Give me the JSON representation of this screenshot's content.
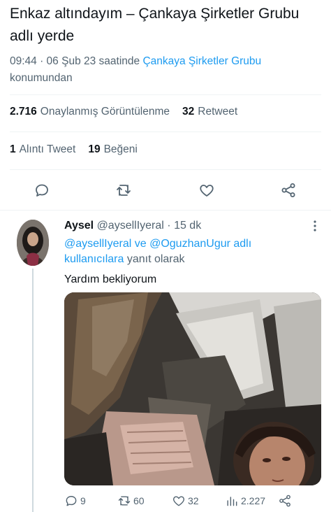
{
  "tweet": {
    "text": "Enkaz altındayım – Çankaya Şirketler Grubu adlı yerde",
    "time": "09:44 · 06 Şub 23 saatinde ",
    "location_link": "Çankaya Şirketler Grubu",
    "location_suffix": "konumundan"
  },
  "stats": {
    "views_count": "2.716",
    "views_label": "Onaylanmış Görüntülenme",
    "retweets_count": "32",
    "retweets_label": "Retweet",
    "quotes_count": "1",
    "quotes_label": "Alıntı Tweet",
    "likes_count": "19",
    "likes_label": "Beğeni"
  },
  "icons": {
    "reply": "reply-icon",
    "retweet": "retweet-icon",
    "like": "heart-icon",
    "share": "share-icon",
    "views": "analytics-icon",
    "more": "more-dots-icon"
  },
  "reply": {
    "name": "Aysel",
    "handle": "@aysellIyeral",
    "sep": " · ",
    "time": "15 dk",
    "reply_prefix_user1": "@aysellIyeral",
    "reply_and": " ve ",
    "reply_prefix_user2": "@OguzhanUgur",
    "reply_suffix_link": " adlı kullanıcılara",
    "reply_suffix_text": " yanıt olarak",
    "body": "Yardım bekliyorum",
    "counts": {
      "replies": "9",
      "retweets": "60",
      "likes": "32",
      "views": "2.227"
    }
  },
  "colors": {
    "accent": "#1d9bf0",
    "text": "#0f1419",
    "secondary": "#536471",
    "divider": "#eff3f4"
  }
}
